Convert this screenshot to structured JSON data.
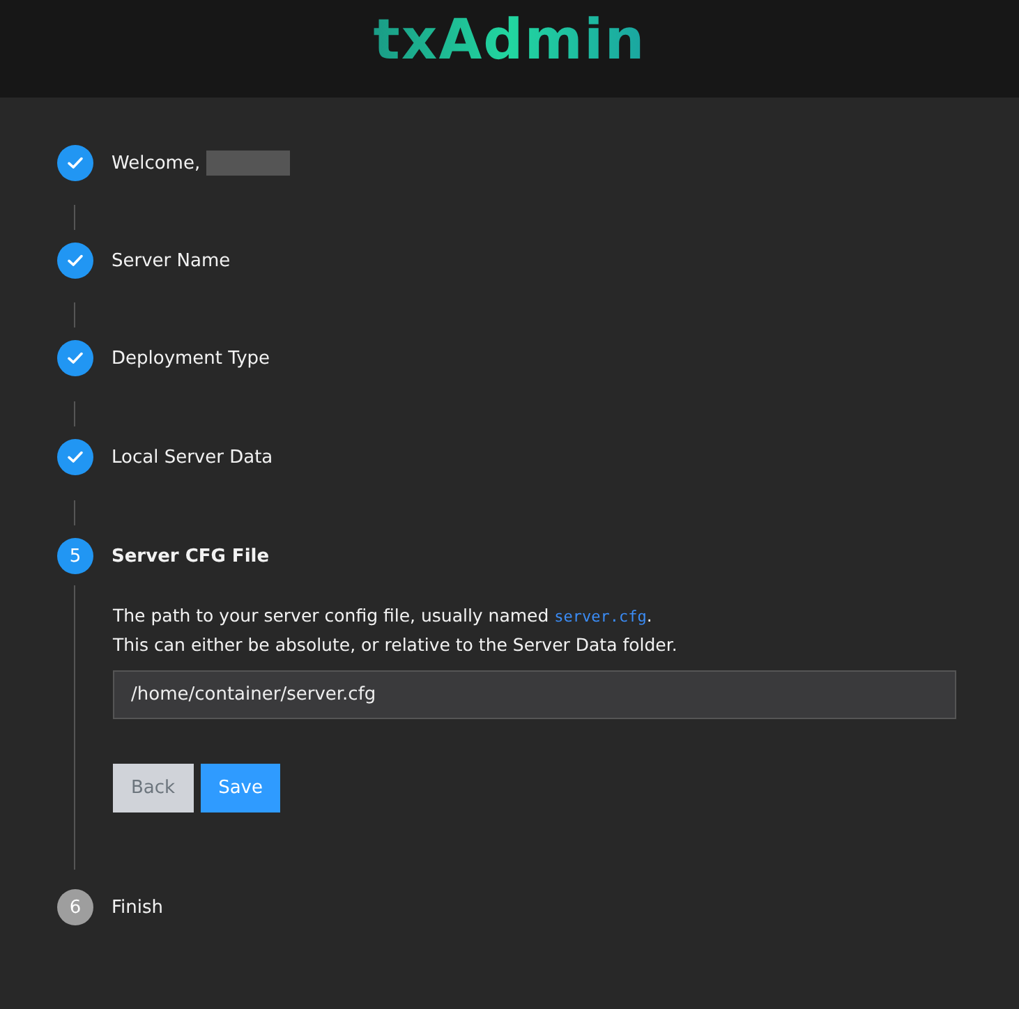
{
  "header": {
    "logo": "txAdmin"
  },
  "steps": [
    {
      "label": "Welcome,",
      "completed": true,
      "selected": false,
      "redacted": true
    },
    {
      "label": "Server Name",
      "completed": true,
      "selected": false
    },
    {
      "label": "Deployment Type",
      "completed": true,
      "selected": false
    },
    {
      "label": "Local Server Data",
      "completed": true,
      "selected": false
    },
    {
      "label": "Server CFG File",
      "completed": false,
      "selected": true,
      "number": "5",
      "description": [
        [
          {
            "kind": "text",
            "text": "The path to your server config file, usually named "
          },
          {
            "kind": "code",
            "text": "server.cfg"
          },
          {
            "kind": "text",
            "text": "."
          }
        ],
        [
          {
            "kind": "text",
            "text": "This can either be absolute, or relative to the Server Data folder."
          }
        ]
      ],
      "field": {
        "value": "/home/container/server.cfg"
      },
      "buttons": [
        {
          "label": "Back",
          "kind": "secondary"
        },
        {
          "label": "Save",
          "kind": "primary"
        }
      ]
    },
    {
      "label": "Finish",
      "completed": false,
      "selected": false,
      "number": "6"
    }
  ]
}
